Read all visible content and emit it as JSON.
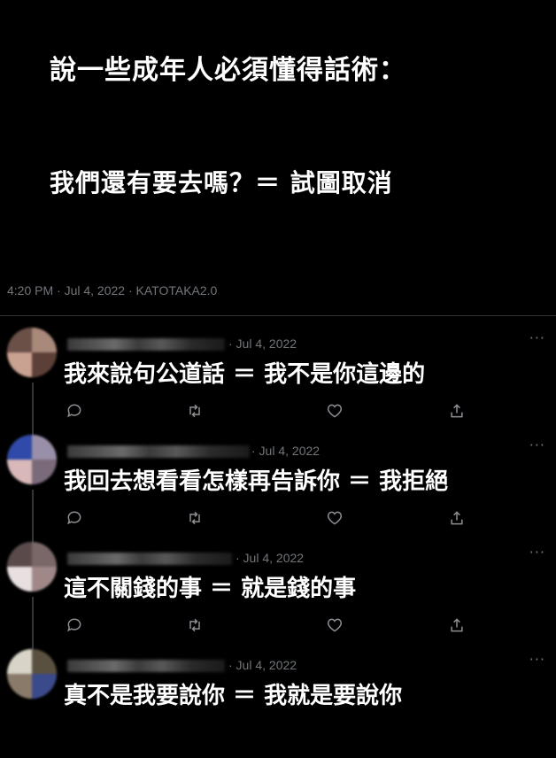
{
  "post": {
    "title": "說一些成年人必須懂得話術：",
    "line": "我們還有要去嗎？＝ 試圖取消",
    "meta": "4:20 PM · Jul 4, 2022 · KATOTAKA2.0"
  },
  "replies": [
    {
      "date": "· Jul 4, 2022",
      "text": "我來說句公道話 ＝ 我不是你這邊的"
    },
    {
      "date": "· Jul 4, 2022",
      "text": "我回去想看看怎樣再告訴你 ＝ 我拒絕"
    },
    {
      "date": "· Jul 4, 2022",
      "text": "這不關錢的事 ＝ 就是錢的事"
    },
    {
      "date": "· Jul 4, 2022",
      "text": "真不是我要說你 ＝ 我就是要說你"
    }
  ],
  "icons": {
    "more": "more-dots-icon",
    "reply": "reply-icon",
    "retweet": "retweet-icon",
    "like": "heart-icon",
    "share": "share-icon"
  },
  "more_glyph": "···",
  "colors": {
    "background": "#000000",
    "text": "#ffffff",
    "muted": "#71767b"
  }
}
